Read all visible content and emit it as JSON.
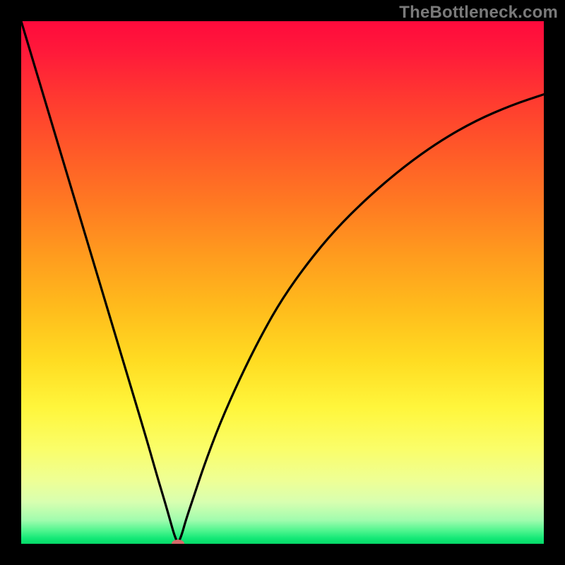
{
  "watermark": "TheBottleneck.com",
  "gradient": {
    "stops": [
      {
        "offset": 0.0,
        "color": "#ff0a3c"
      },
      {
        "offset": 0.06,
        "color": "#ff1a3a"
      },
      {
        "offset": 0.15,
        "color": "#ff3a30"
      },
      {
        "offset": 0.25,
        "color": "#ff5a28"
      },
      {
        "offset": 0.35,
        "color": "#ff7a22"
      },
      {
        "offset": 0.45,
        "color": "#ff9c1e"
      },
      {
        "offset": 0.55,
        "color": "#ffbc1c"
      },
      {
        "offset": 0.65,
        "color": "#ffdc22"
      },
      {
        "offset": 0.74,
        "color": "#fff63c"
      },
      {
        "offset": 0.82,
        "color": "#fafe6a"
      },
      {
        "offset": 0.88,
        "color": "#eeff96"
      },
      {
        "offset": 0.92,
        "color": "#d8ffb0"
      },
      {
        "offset": 0.955,
        "color": "#a0fcae"
      },
      {
        "offset": 0.975,
        "color": "#4ef58e"
      },
      {
        "offset": 0.99,
        "color": "#12e876"
      },
      {
        "offset": 1.0,
        "color": "#06d868"
      }
    ]
  },
  "chart_data": {
    "type": "line",
    "title": "",
    "xlabel": "",
    "ylabel": "",
    "xlim": [
      0,
      100
    ],
    "ylim": [
      0,
      100
    ],
    "series": [
      {
        "name": "bottleneck-curve",
        "x": [
          0,
          3,
          6,
          9,
          12,
          15,
          18,
          21,
          24,
          26,
          27.5,
          28.5,
          29.2,
          29.7,
          30,
          30.3,
          30.8,
          31.5,
          33,
          35,
          38,
          42,
          46,
          50,
          55,
          60,
          66,
          73,
          80,
          87,
          94,
          100
        ],
        "y": [
          100,
          90,
          80,
          70,
          60,
          50,
          40,
          30,
          20,
          13,
          8,
          4.5,
          2,
          0.7,
          0,
          0.7,
          2,
          4.5,
          9,
          15,
          23,
          32,
          40,
          47,
          54,
          60,
          66,
          72,
          77,
          81,
          84,
          86
        ]
      }
    ],
    "marker": {
      "x": 30,
      "y": 0,
      "color": "#d46a6a",
      "rx": 9,
      "ry": 6
    }
  }
}
